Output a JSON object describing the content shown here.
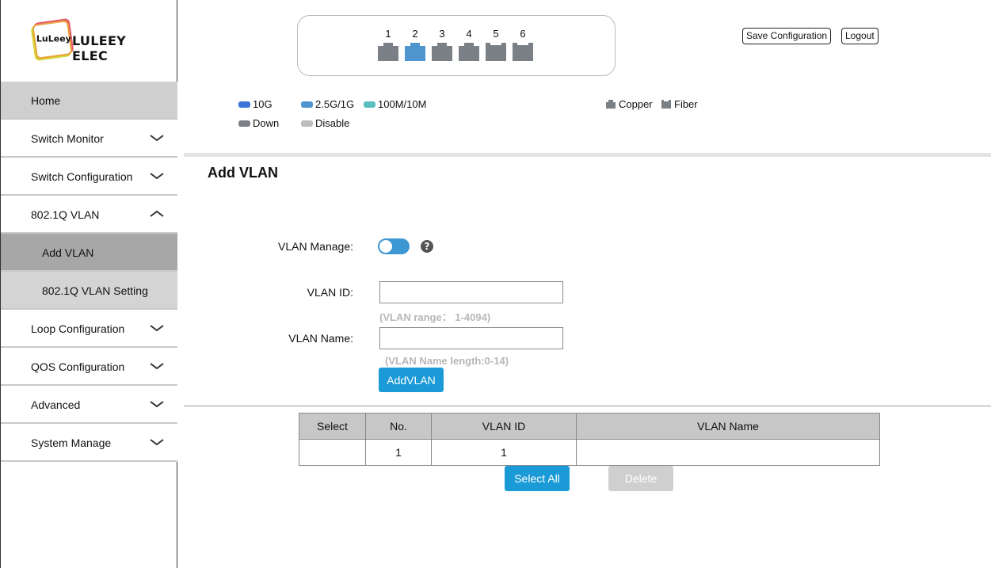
{
  "brand": {
    "badge_text": "LuLeey",
    "name": "LULEEY ELEC"
  },
  "sidebar": {
    "items": [
      {
        "label": "Home"
      },
      {
        "label": "Switch Monitor"
      },
      {
        "label": "Switch Configuration"
      },
      {
        "label": "802.1Q VLAN"
      },
      {
        "label": "Add VLAN"
      },
      {
        "label": "802.1Q VLAN Setting"
      },
      {
        "label": "Loop Configuration"
      },
      {
        "label": "QOS Configuration"
      },
      {
        "label": "Advanced"
      },
      {
        "label": "System Manage"
      }
    ]
  },
  "ports": [
    {
      "num": "1",
      "color": "#7b7f86",
      "type": "copper"
    },
    {
      "num": "2",
      "color": "#4e95cf",
      "type": "copper"
    },
    {
      "num": "3",
      "color": "#7b7f86",
      "type": "copper"
    },
    {
      "num": "4",
      "color": "#7b7f86",
      "type": "copper"
    },
    {
      "num": "5",
      "color": "#7b7f86",
      "type": "fiber"
    },
    {
      "num": "6",
      "color": "#7b7f86",
      "type": "fiber"
    }
  ],
  "header": {
    "save_label": "Save Configuration",
    "logout_label": "Logout"
  },
  "legend": {
    "speed_10g": "10G",
    "speed_25g": "2.5G/1G",
    "speed_100m": "100M/10M",
    "down": "Down",
    "disable": "Disable",
    "copper": "Copper",
    "fiber": "Fiber",
    "colors": {
      "10g": "#3d74d9",
      "25g": "#4e95cf",
      "100m": "#5bbfc2",
      "down": "#7b7f86",
      "disable": "#bdbdbd"
    }
  },
  "page": {
    "title": "Add VLAN",
    "vlan_manage_label": "VLAN Manage:",
    "vlan_id_label": "VLAN ID:",
    "vlan_id_value": "",
    "vlan_id_hint": "(VLAN range： 1-4094)",
    "vlan_name_label": "VLAN Name:",
    "vlan_name_value": "",
    "vlan_name_hint": "(VLAN Name length:0-14)",
    "add_button": "AddVLAN",
    "help_glyph": "?"
  },
  "table": {
    "headers": [
      "Select",
      "No.",
      "VLAN ID",
      "VLAN Name"
    ],
    "rows": [
      {
        "select": "",
        "no": "1",
        "vlan_id": "1",
        "vlan_name": ""
      }
    ]
  },
  "actions": {
    "select_all": "Select All",
    "delete": "Delete"
  }
}
